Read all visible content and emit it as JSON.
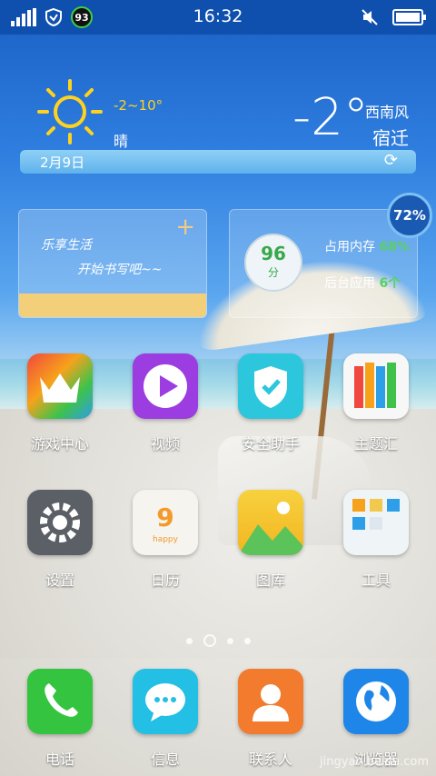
{
  "status_bar": {
    "time": "16:32",
    "badge": "93",
    "icons": [
      "signal-icon",
      "shield-icon",
      "mute-icon",
      "battery-icon"
    ]
  },
  "weather": {
    "range": "-2~10°",
    "condition": "晴",
    "temp": "-2°",
    "wind": "西南风",
    "city": "宿迁",
    "date": "2月9日",
    "icons": [
      "sun-icon",
      "refresh-icon"
    ]
  },
  "note_widget": {
    "line1": "乐享生活",
    "line2": "开始书写吧~~",
    "add_icon": "plus-icon"
  },
  "memory_widget": {
    "score": "96",
    "score_unit": "分",
    "memory_label": "占用内存",
    "memory_value": "68%",
    "background_label": "后台应用",
    "background_value": "6个",
    "float_percent": "72%"
  },
  "apps": [
    {
      "label": "游戏中心",
      "icon": "crown-icon"
    },
    {
      "label": "视频",
      "icon": "play-icon"
    },
    {
      "label": "安全助手",
      "icon": "shield-check-icon"
    },
    {
      "label": "主题汇",
      "icon": "pencils-icon"
    },
    {
      "label": "设置",
      "icon": "gear-icon"
    },
    {
      "label": "日历",
      "icon": "calendar-icon",
      "day": "9",
      "sub": "happy"
    },
    {
      "label": "图库",
      "icon": "mountain-icon"
    },
    {
      "label": "工具",
      "icon": "toolbox-icon"
    }
  ],
  "dock": [
    {
      "label": "电话",
      "icon": "phone-icon"
    },
    {
      "label": "信息",
      "icon": "chat-icon"
    },
    {
      "label": "联系人",
      "icon": "person-icon"
    },
    {
      "label": "浏览器",
      "icon": "globe-icon"
    }
  ],
  "watermark": "jingyan.baidu.com",
  "colors": {
    "status_bar": "#0f4fae",
    "accent_green": "#59d065",
    "weather_yellow": "#ffd21f"
  }
}
